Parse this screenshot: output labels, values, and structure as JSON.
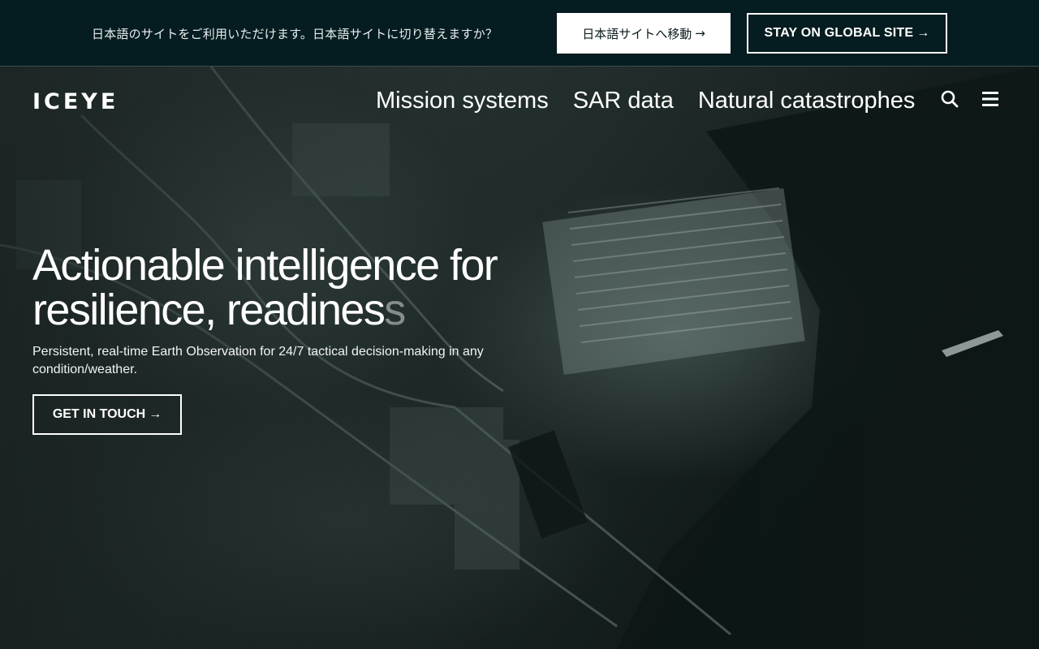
{
  "banner": {
    "message": "日本語のサイトをご利用いただけます。日本語サイトに切り替えますか？",
    "jp_button_label": "日本語サイトへ移動",
    "global_button_label": "STAY ON GLOBAL SITE",
    "arrow": "→"
  },
  "header": {
    "logo_text": "ICEYE",
    "nav_items": [
      {
        "label": "Mission systems"
      },
      {
        "label": "SAR data"
      },
      {
        "label": "Natural catastrophes"
      }
    ],
    "search_icon": "search-icon",
    "menu_icon": "hamburger-menu-icon"
  },
  "hero": {
    "title_main": "Actionable intelligence for resilience, readines",
    "title_faded": "s",
    "subtitle": "Persistent, real-time Earth Observation for 24/7 tactical decision-making in any condition/weather.",
    "cta_label": "GET IN TOUCH",
    "arrow": "→"
  },
  "colors": {
    "banner_bg": "#051c20",
    "hero_bg": "#1f2a29",
    "text": "#ffffff"
  }
}
